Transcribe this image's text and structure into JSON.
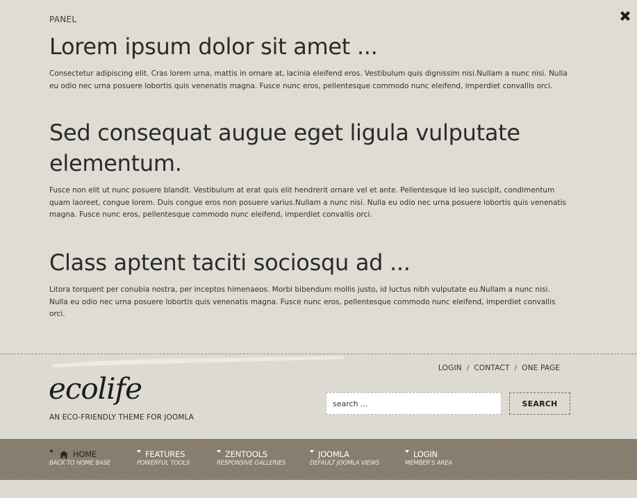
{
  "panel": {
    "label": "PANEL",
    "sections": [
      {
        "heading": "Lorem ipsum dolor sit amet ...",
        "body": "Consectetur adipiscing elit. Cras lorem urna, mattis in ornare at, lacinia eleifend eros. Vestibulum quis dignissim nisi.Nullam a nunc nisi. Nulla eu odio nec urna posuere lobortis quis venenatis magna. Fusce nunc eros, pellentesque commodo nunc eleifend, imperdiet convallis orci."
      },
      {
        "heading": "Sed consequat augue eget ligula vulputate elementum.",
        "body": "Fusce non elit ut nunc posuere blandit. Vestibulum at erat quis elit hendrerit ornare vel et ante. Pellentesque id leo suscipit, condimentum quam laoreet, congue lorem. Duis congue eros non posuere varius.Nullam a nunc nisi. Nulla eu odio nec urna posuere lobortis quis venenatis magna. Fusce nunc eros, pellentesque commodo nunc eleifend, imperdiet convallis orci."
      },
      {
        "heading": "Class aptent taciti sociosqu ad ...",
        "body": "Litora torquent per conubia nostra, per inceptos himenaeos. Morbi bibendum mollis justo, id luctus nibh vulputate eu.Nullam a nunc nisi. Nulla eu odio nec urna posuere lobortis quis venenatis magna. Fusce nunc eros, pellentesque commodo nunc eleifend, imperdiet convallis orci."
      }
    ],
    "close_icon": "close-icon"
  },
  "top_links": [
    "LOGIN",
    "CONTACT",
    "ONE PAGE"
  ],
  "top_links_separator": "/",
  "logo": {
    "text": "ecolife",
    "tagline": "AN ECO-FRIENDLY THEME FOR JOOMLA"
  },
  "search": {
    "placeholder": "search ...",
    "button_label": "SEARCH"
  },
  "nav": {
    "items": [
      {
        "title": "HOME",
        "subtitle": "BACK TO HOME BASE",
        "icon": "home-icon",
        "active": true
      },
      {
        "title": "FEATURES",
        "subtitle": "POWERFUL TOOLS",
        "active": false
      },
      {
        "title": "ZENTOOLS",
        "subtitle": "RESPONSIVE GALLERIES",
        "active": false
      },
      {
        "title": "JOOMLA",
        "subtitle": "DEFAULT JOOMLA VIEWS",
        "active": false
      },
      {
        "title": "LOGIN",
        "subtitle": "MEMBER'S AREA",
        "active": false
      }
    ]
  },
  "colors": {
    "background": "#dcdad1",
    "nav_background": "#857c6e",
    "text": "#2b2b2b"
  }
}
